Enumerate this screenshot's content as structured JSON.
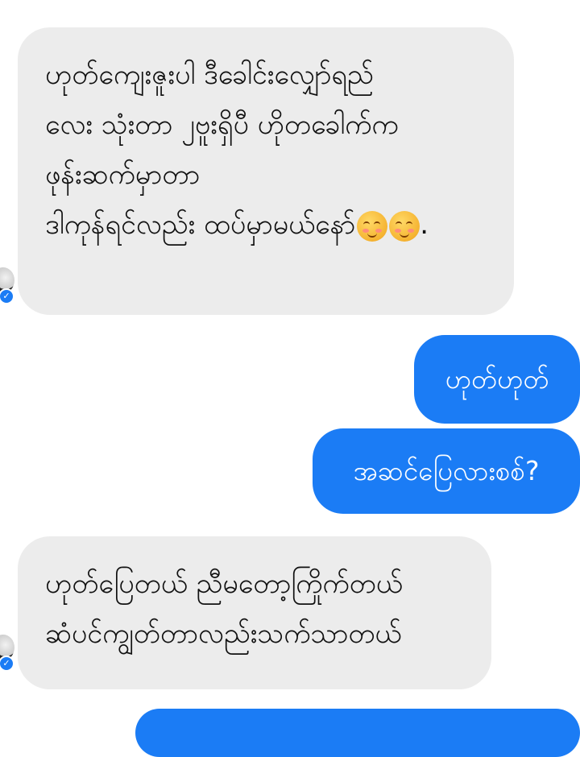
{
  "messages": [
    {
      "direction": "incoming",
      "lines": [
        "ဟုတ်ကျေးဇူးပါ ဒီခေါင်းလျှော်ရည်",
        "လေး သုံးတာ ၂ဗူးရှိပီ ဟိုတခေါက်က",
        "ဖုန်းဆက်မှာတာ",
        "ဒါကုန်ရင်လည်း ထပ်မှာမယ်နော်"
      ],
      "emojis": [
        "smiling-face-with-blush",
        "smiling-face-with-blush"
      ],
      "trailing": "."
    },
    {
      "direction": "outgoing",
      "text": "ဟုတ်ဟုတ်"
    },
    {
      "direction": "outgoing",
      "text": "အဆင်ပြေလားစစ်?"
    },
    {
      "direction": "incoming",
      "lines": [
        "ဟုတ်ပြေတယ် ညီမတော့ကြိုက်တယ်",
        "ဆံပင်ကျွတ်တာလည်းသက်သာတယ်"
      ]
    }
  ],
  "colors": {
    "incoming_bubble": "#ececec",
    "outgoing_bubble": "#1b7cf5",
    "incoming_text": "#111111",
    "outgoing_text": "#ffffff"
  }
}
